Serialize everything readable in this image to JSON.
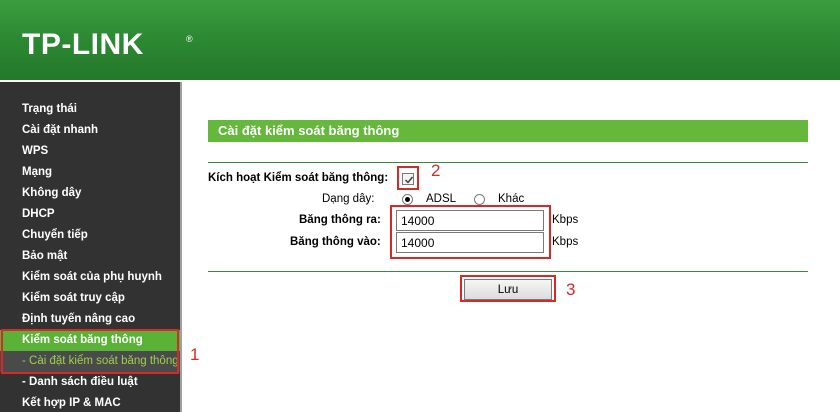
{
  "brand": {
    "logo_text": "TP-LINK",
    "registered": "®"
  },
  "sidebar": {
    "items": [
      {
        "label": "Trạng thái"
      },
      {
        "label": "Cài đặt nhanh"
      },
      {
        "label": "WPS"
      },
      {
        "label": "Mạng"
      },
      {
        "label": "Không dây"
      },
      {
        "label": "DHCP"
      },
      {
        "label": "Chuyển tiếp"
      },
      {
        "label": "Bảo mật"
      },
      {
        "label": "Kiểm soát của phụ huynh"
      },
      {
        "label": "Kiểm soát truy cập"
      },
      {
        "label": "Định tuyến nâng cao"
      },
      {
        "label": "Kiểm soát băng thông"
      },
      {
        "label": "- Cài đặt kiểm soát băng thông"
      },
      {
        "label": "- Danh sách điều luật"
      },
      {
        "label": "Kết hợp IP & MAC"
      }
    ]
  },
  "main": {
    "title": "Cài đặt kiểm soát băng thông",
    "enable_label": "Kích hoạt Kiểm soát băng thông:",
    "enable_checked": true,
    "line_type_label": "Dạng dây:",
    "line_options": [
      {
        "label": "ADSL",
        "selected": true
      },
      {
        "label": "Khác",
        "selected": false
      }
    ],
    "egress_label": "Băng thông ra:",
    "egress_value": "14000",
    "ingress_label": "Băng thông vào:",
    "ingress_value": "14000",
    "unit": "Kbps",
    "save_label": "Lưu"
  },
  "annotations": {
    "one": "1",
    "two": "2",
    "three": "3",
    "color": "#d42a2a"
  },
  "colors": {
    "header_green": "#2d8a33",
    "title_green": "#65b83c",
    "sidebar_bg": "#323232",
    "active_green": "#5ab336",
    "sub_active_text": "#9bd34a"
  }
}
